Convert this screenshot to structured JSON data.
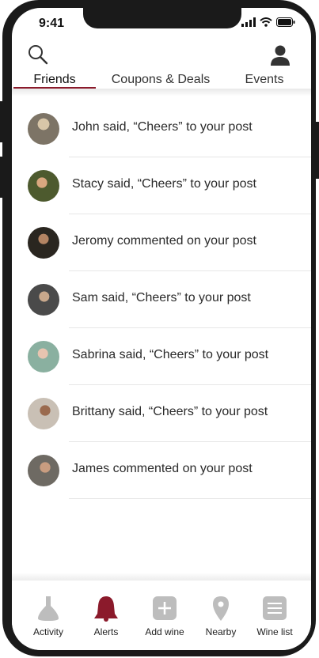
{
  "status_bar": {
    "time": "9:41"
  },
  "tabs": [
    {
      "label": "Friends",
      "active": true
    },
    {
      "label": "Coupons & Deals",
      "active": false
    },
    {
      "label": "Events",
      "active": false
    }
  ],
  "notifications": [
    {
      "text": "John said, “Cheers” to your post",
      "avatar_color": "#7d7466"
    },
    {
      "text": "Stacy said, “Cheers” to your post",
      "avatar_color": "#4d5a2e"
    },
    {
      "text": "Jeromy commented on your post",
      "avatar_color": "#2a2620"
    },
    {
      "text": "Sam said, “Cheers” to your post",
      "avatar_color": "#4a4a4a"
    },
    {
      "text": "Sabrina said, “Cheers” to your post",
      "avatar_color": "#8ab0a0"
    },
    {
      "text": "Brittany said, “Cheers” to your post",
      "avatar_color": "#c9c0b5"
    },
    {
      "text": "James commented on your post",
      "avatar_color": "#6e6a63"
    }
  ],
  "bottom_nav": [
    {
      "label": "Activity",
      "icon": "wine-glass-icon",
      "active": false
    },
    {
      "label": "Alerts",
      "icon": "bell-icon",
      "active": true
    },
    {
      "label": "Add wine",
      "icon": "plus-icon",
      "active": false
    },
    {
      "label": "Nearby",
      "icon": "location-pin-icon",
      "active": false
    },
    {
      "label": "Wine list",
      "icon": "list-icon",
      "active": false
    }
  ],
  "colors": {
    "accent": "#8b1a2b",
    "icon_gray": "#bdbdbd"
  }
}
